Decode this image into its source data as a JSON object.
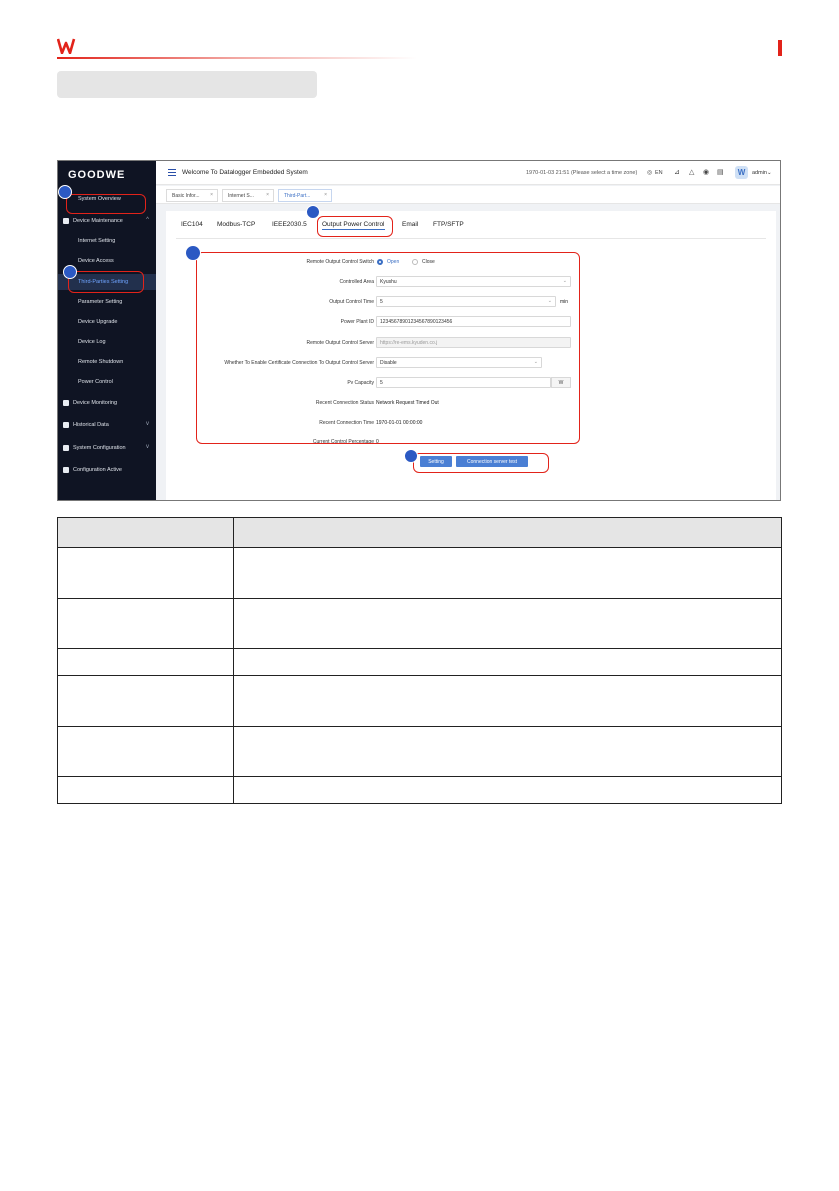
{
  "colors": {
    "brand": "#e2231a",
    "accent": "#4a7fd4",
    "callout": "#2b59c3",
    "sidebar": "#0f1423"
  },
  "screenshot": {
    "sidebar": {
      "logo": "GOODWE",
      "items": [
        {
          "label": "System Overview",
          "icon": "none"
        },
        {
          "label": "Device Maintenance",
          "icon": "shield-icon"
        },
        {
          "label": "Internet Setting"
        },
        {
          "label": "Device Access"
        },
        {
          "label": "Third-Parties Setting"
        },
        {
          "label": "Parameter Setting"
        },
        {
          "label": "Device Upgrade"
        },
        {
          "label": "Device Log"
        },
        {
          "label": "Remote Shutdown"
        },
        {
          "label": "Power Control"
        },
        {
          "label": "Device Monitoring",
          "icon": "monitor-icon"
        },
        {
          "label": "Historical Data",
          "icon": "chart-icon"
        },
        {
          "label": "System Configuration",
          "icon": "gear-icon"
        },
        {
          "label": "Configuration Active",
          "icon": "document-icon"
        }
      ]
    },
    "topbar": {
      "title": "Welcome To Datalogger Embedded System",
      "time": "1970-01-03 21:51 (Please select a time zone)",
      "language": "EN",
      "user": "admin"
    },
    "tabs": [
      "Basic Infor...",
      "Internet S...",
      "Third-Part..."
    ],
    "protocol_tabs": [
      "IEC104",
      "Modbus-TCP",
      "IEEE2030.5",
      "Output Power Control",
      "Email",
      "FTP/SFTP"
    ],
    "form": {
      "switch_label": "Remote Output Control Switch",
      "switch_open": "Open",
      "switch_close": "Close",
      "area_label": "Controlled Area",
      "area_value": "Kyushu",
      "time_label": "Output Control Time",
      "time_value": "5",
      "time_unit": "min",
      "plant_label": "Power Plant ID",
      "plant_value": "123456789012345678901234​56",
      "server_label": "Remote Output Control Server",
      "server_value": "https://re-ems.kyuden.co.j",
      "cert_label": "Whether To Enable Certificate Connection To Output Control Server",
      "cert_value": "Disable",
      "pv_label": "Pv Capacity",
      "pv_value": "5",
      "pv_unit": "W",
      "status_label": "Recent Connection Status",
      "status_value": "Network Request Timed Out",
      "conn_time_label": "Recent Connection Time",
      "conn_time_value": "1970-01-01 00:00:00",
      "percent_label": "Current Control Percentage",
      "percent_value": "0"
    },
    "buttons": {
      "setting": "Setting",
      "test": "Connection server test"
    }
  }
}
